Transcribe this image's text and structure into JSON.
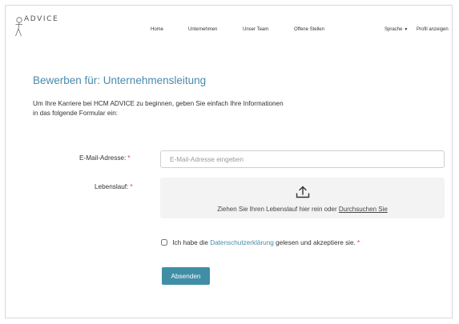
{
  "header": {
    "logo_text": "ADVICE",
    "nav": {
      "home": "Home",
      "companies": "Unternehmen",
      "team": "Unser Team",
      "jobs": "Offene Stellen",
      "language": "Sprache",
      "profile": "Profil anzeigen"
    }
  },
  "page": {
    "title": "Bewerben für: Unternehmensleitung",
    "intro": "Um Ihre Karriere bei HCM ADVICE zu beginnen, geben Sie einfach Ihre Informationen in das folgende Formular ein:"
  },
  "form": {
    "email_label": "E-Mail-Adresse:",
    "email_placeholder": "E-Mail-Adresse eingeben",
    "email_value": "",
    "cv_label": "Lebenslauf:",
    "required_mark": "*",
    "dropzone_text": "Ziehen Sie Ihren Lebenslauf hier rein oder",
    "dropzone_link": "Durchsuchen Sie",
    "consent_before": "Ich habe die",
    "consent_link": "Datenschutzerklärung",
    "consent_after": "gelesen und akzeptiere sie.",
    "consent_checked": false,
    "submit_label": "Absenden"
  },
  "colors": {
    "title": "#4a8aaa",
    "link": "#4a8aaa",
    "required": "#e0314b",
    "button": "#3f8ea6",
    "dropzone_bg": "#f3f3f3"
  },
  "icons": {
    "logo": "stick-figure-logo-icon",
    "language_caret": "caret-down-icon",
    "upload": "upload-icon"
  }
}
